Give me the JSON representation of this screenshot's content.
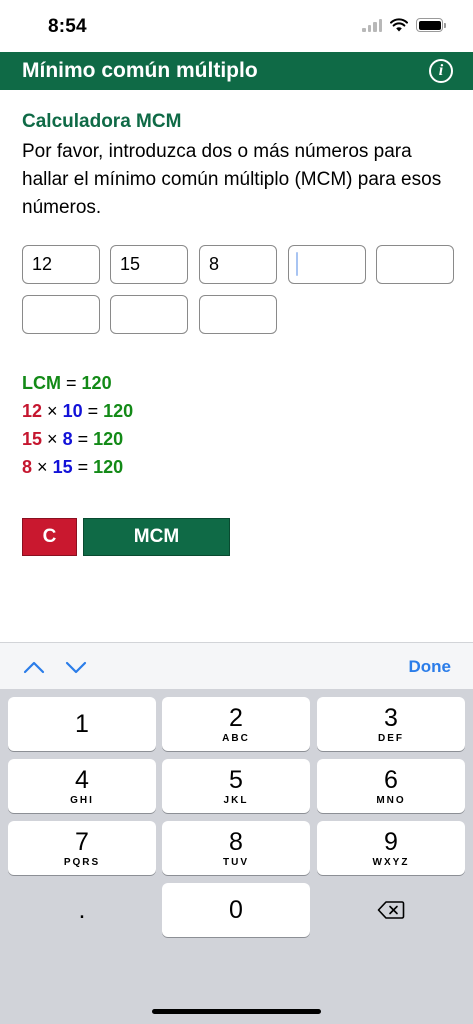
{
  "status": {
    "time": "8:54"
  },
  "header": {
    "title": "Mínimo común múltiplo",
    "info_icon": "info-icon"
  },
  "intro": {
    "heading": "Calculadora MCM",
    "text": "Por favor, introduzca dos o más números para hallar el mínimo común múltiplo (MCM) para esos números."
  },
  "inputs": [
    "12",
    "15",
    "8",
    "",
    "",
    "",
    "",
    ""
  ],
  "results": {
    "lcm_label": "LCM",
    "lcm_value": "120",
    "rows": [
      {
        "a": "12",
        "b": "10",
        "product": "120"
      },
      {
        "a": "15",
        "b": "8",
        "product": "120"
      },
      {
        "a": "8",
        "b": "15",
        "product": "120"
      }
    ],
    "times_symbol": "×",
    "equals_symbol": "="
  },
  "buttons": {
    "clear": "C",
    "calculate": "MCM"
  },
  "keyboard": {
    "done": "Done",
    "keys": [
      {
        "digit": "1",
        "letters": ""
      },
      {
        "digit": "2",
        "letters": "ABC"
      },
      {
        "digit": "3",
        "letters": "DEF"
      },
      {
        "digit": "4",
        "letters": "GHI"
      },
      {
        "digit": "5",
        "letters": "JKL"
      },
      {
        "digit": "6",
        "letters": "MNO"
      },
      {
        "digit": "7",
        "letters": "PQRS"
      },
      {
        "digit": "8",
        "letters": "TUV"
      },
      {
        "digit": "9",
        "letters": "WXYZ"
      },
      {
        "digit": ".",
        "letters": ""
      },
      {
        "digit": "0",
        "letters": ""
      }
    ]
  },
  "colors": {
    "brand_green": "#0f6a46",
    "result_green": "#138a17",
    "result_red": "#c5162f",
    "result_blue": "#1212d8",
    "clear_red": "#c9182f",
    "link_blue": "#2b7de9"
  }
}
